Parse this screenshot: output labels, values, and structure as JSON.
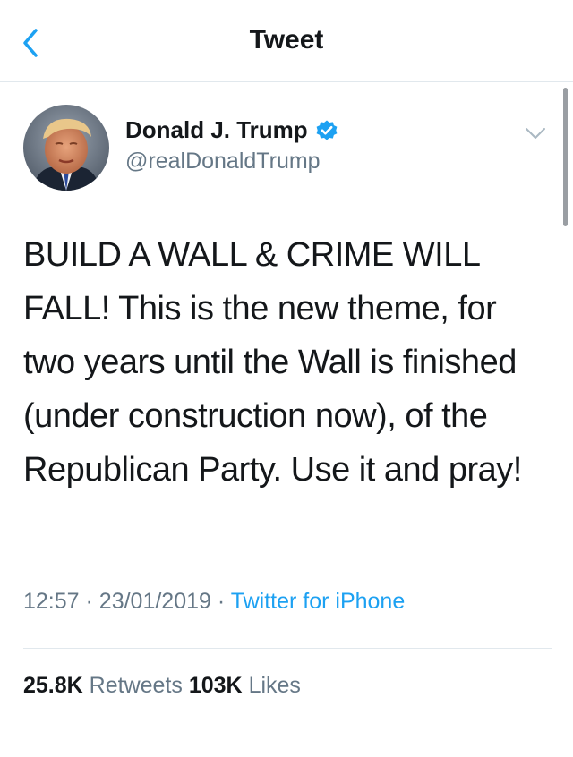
{
  "nav": {
    "title": "Tweet",
    "back_icon": "chevron-left-icon"
  },
  "author": {
    "name": "Donald J. Trump",
    "handle": "@realDonaldTrump",
    "verified_icon": "verified-badge-icon"
  },
  "tweet": {
    "text": "BUILD A WALL & CRIME WILL FALL! This is the new theme, for two years until the Wall is finished (under construction now), of the Republican Party. Use it and pray!",
    "time": "12:57",
    "separator": "·",
    "date": "23/01/2019",
    "source": "Twitter for iPhone"
  },
  "stats": {
    "retweets_count": "25.8K",
    "retweets_label": "Retweets",
    "likes_count": "103K",
    "likes_label": "Likes"
  },
  "colors": {
    "accent": "#1da1f2",
    "text": "#14171a",
    "secondary": "#657786",
    "border": "#e1e8ed"
  }
}
